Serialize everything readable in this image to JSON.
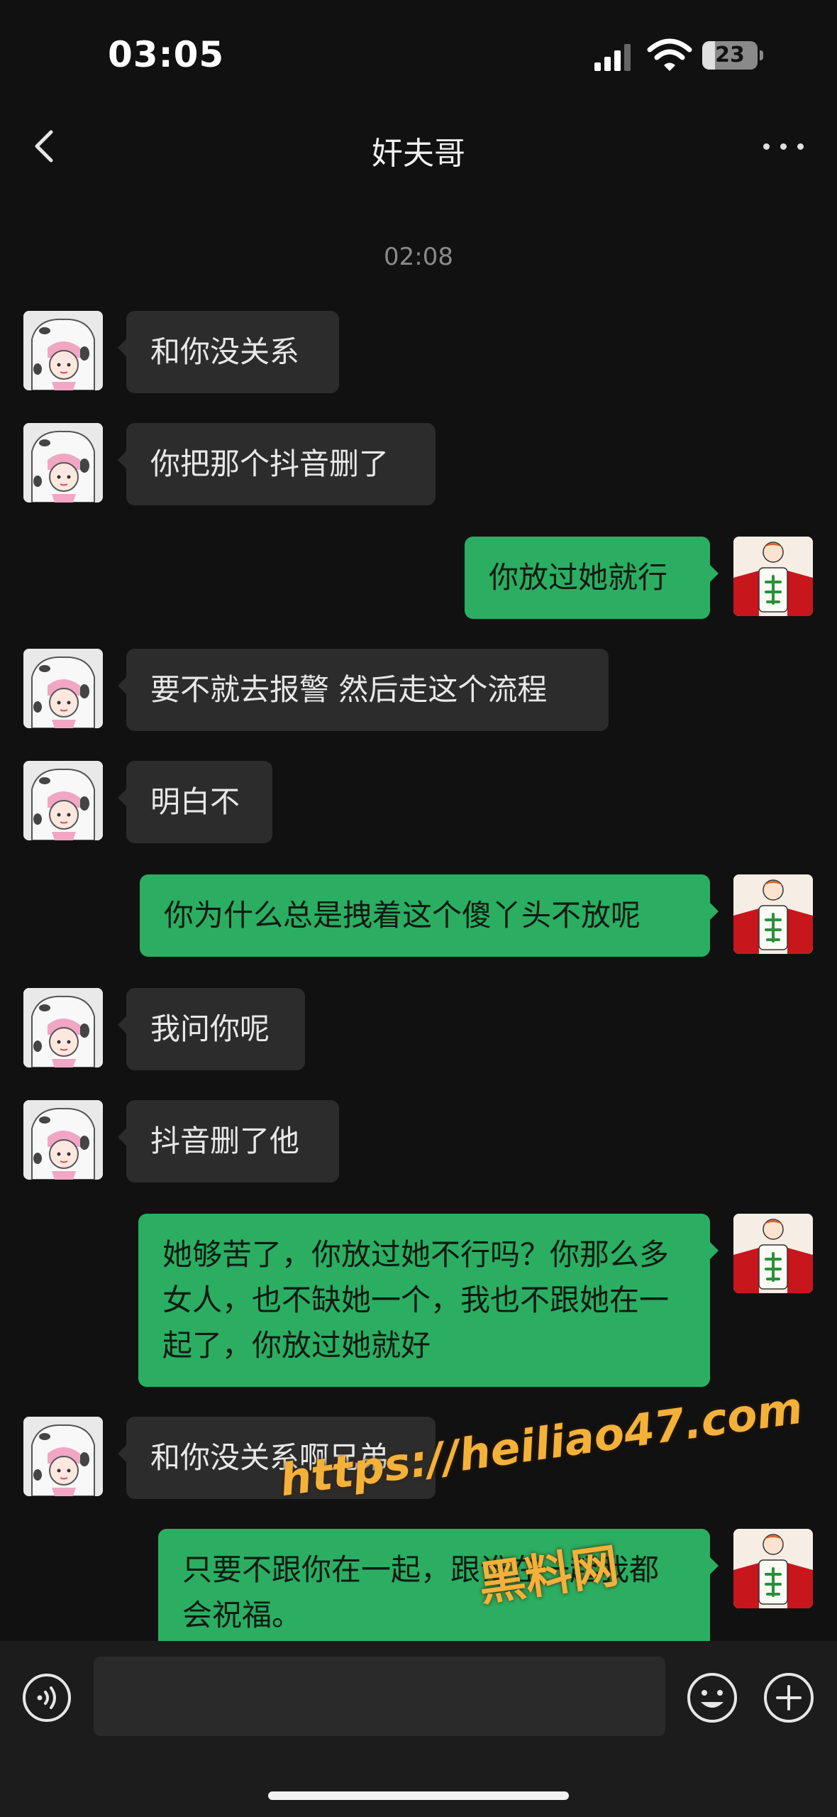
{
  "status_bar": {
    "time": "03:05",
    "battery_level": "23"
  },
  "nav": {
    "title": "奸夫哥",
    "back_icon": "chevron-left-icon",
    "more_icon": "more-dots-icon"
  },
  "chat": {
    "timestamp": "02:08",
    "messages": [
      {
        "side": "in",
        "text": "和你没关系"
      },
      {
        "side": "in",
        "text": "你把那个抖音删了"
      },
      {
        "side": "out",
        "text": "你放过她就行"
      },
      {
        "side": "in",
        "text": "要不就去报警 然后走这个流程"
      },
      {
        "side": "in",
        "text": "明白不"
      },
      {
        "side": "out",
        "text": "你为什么总是拽着这个傻丫头不放呢"
      },
      {
        "side": "in",
        "text": "我问你呢"
      },
      {
        "side": "in",
        "text": "抖音删了他"
      },
      {
        "side": "out",
        "text": "她够苦了，你放过她不行吗？你那么多女人，也不缺她一个，我也不跟她在一起了，你放过她就好"
      },
      {
        "side": "in",
        "text": "和你没关系啊兄弟"
      },
      {
        "side": "out",
        "text": "只要不跟你在一起，跟谁在一起我都会祝福。"
      }
    ]
  },
  "watermark": {
    "url": "https://heiliao47.com",
    "name": "黑料网"
  },
  "input_bar": {
    "placeholder": "",
    "voice_icon": "voice-icon",
    "emoji_icon": "emoji-icon",
    "plus_icon": "plus-icon"
  },
  "colors": {
    "background": "#111111",
    "incoming_bubble": "#2c2c2c",
    "outgoing_bubble": "#2bae62",
    "watermark": "#f4b13a"
  }
}
